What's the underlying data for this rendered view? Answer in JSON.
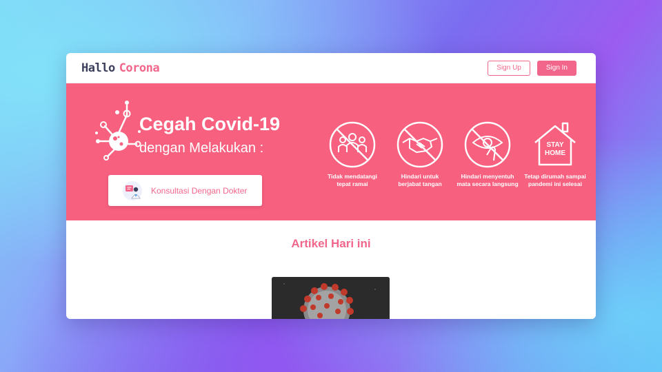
{
  "navbar": {
    "logo_part1": "Hallo",
    "logo_part2": "Corona",
    "signup_label": "Sign Up",
    "signin_label": "Sign In"
  },
  "hero": {
    "title": "Cegah Covid-19",
    "subtitle": "dengan Melakukan :",
    "consult_label": "Konsultasi Dengan Dokter",
    "tips": [
      {
        "icon": "crowd-icon",
        "label": "Tidak mendatangi tepat ramai"
      },
      {
        "icon": "handshake-icon",
        "label": "Hindari untuk berjabat tangan"
      },
      {
        "icon": "eye-touch-icon",
        "label": "Hindari menyentuh mata secara langsung"
      },
      {
        "icon": "stay-home-icon",
        "label": "Tetap dirumah sampai pandemi ini selesai",
        "badge_text_1": "STAY",
        "badge_text_2": "HOME"
      }
    ]
  },
  "articles": {
    "title": "Artikel Hari ini"
  },
  "colors": {
    "brand": "#f2668b",
    "hero_bg": "#f7607f",
    "logo_dark": "#3b3f5c"
  }
}
